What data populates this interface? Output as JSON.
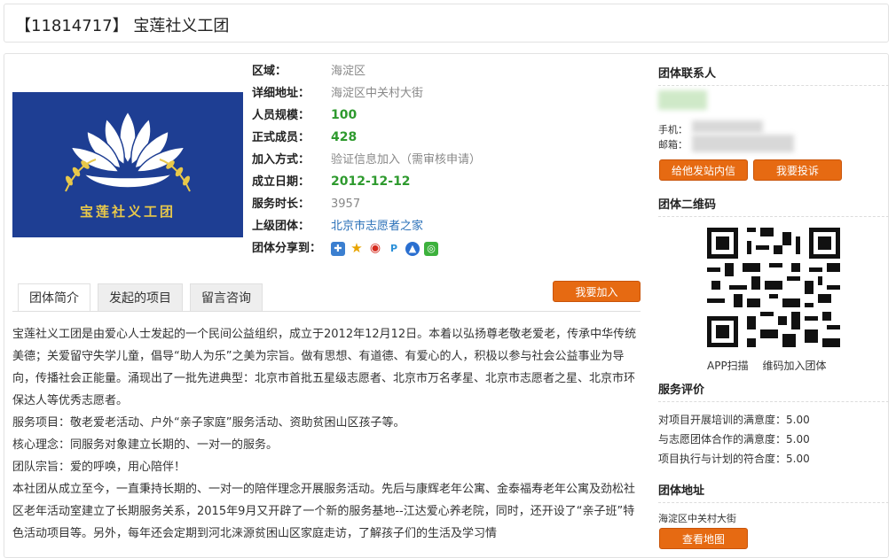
{
  "header": {
    "title": "【11814717】 宝莲社义工团"
  },
  "logo": {
    "text": "宝莲社义工团",
    "bg": "#1e3e93"
  },
  "info": {
    "region_label": "区域：",
    "region": "海淀区",
    "address_label": "详细地址：",
    "address": "海淀区中关村大街",
    "size_label": "人员规模：",
    "size": "100",
    "members_label": "正式成员：",
    "members": "428",
    "join_label": "加入方式：",
    "join": "验证信息加入（需审核申请）",
    "date_label": "成立日期：",
    "date": "2012-12-12",
    "hours_label": "服务时长：",
    "hours": "3957",
    "parent_label": "上级团体：",
    "parent": "北京市志愿者之家",
    "share_label": "团体分享到："
  },
  "tabs": [
    "团体简介",
    "发起的项目",
    "留言咨询"
  ],
  "join_button": "我要加入",
  "description": [
    "宝莲社义工团是由爱心人士发起的一个民间公益组织，成立于2012年12月12日。本着以弘扬尊老敬老爱老，传承中华传统美德；关爱留守失学儿童，倡导“助人为乐”之美为宗旨。做有思想、有道德、有爱心的人，积极以参与社会公益事业为导向，传播社会正能量。涌现出了一批先进典型：北京市首批五星级志愿者、北京市万名孝星、北京市志愿者之星、北京市环保达人等优秀志愿者。",
    "服务项目：敬老爱老活动、户外“亲子家庭”服务活动、资助贫困山区孩子等。",
    "核心理念：同服务对象建立长期的、一对一的服务。",
    "团队宗旨：爱的呼唤，用心陪伴！",
    "本社团从成立至今，一直秉持长期的、一对一的陪伴理念开展服务活动。先后与康辉老年公寓、金泰福寿老年公寓及劲松社区老年活动室建立了长期服务关系，2015年9月又开辟了一个新的服务基地--江达爱心养老院，同时，还开设了“亲子班”特色活动项目等。另外，每年还会定期到河北涞源贫困山区家庭走访，了解孩子们的生活及学习情"
  ],
  "sidebar": {
    "contact_title": "团体联系人",
    "phone_label": "手机：",
    "email_label": "邮箱：",
    "message_button": "给他发站内信",
    "complain_button": "我要投诉",
    "qr_title": "团体二维码",
    "qr_caption": "APP扫描　 维码加入团体",
    "eval_title": "服务评价",
    "evals": [
      {
        "label": "对项目开展培训的满意度：",
        "score": "5.00"
      },
      {
        "label": "与志愿团体合作的满意度：",
        "score": "5.00"
      },
      {
        "label": "项目执行与计划的符合度：",
        "score": "5.00"
      }
    ],
    "address_title": "团体地址",
    "address": "海淀区中关村大街",
    "map_button": "查看地图"
  }
}
